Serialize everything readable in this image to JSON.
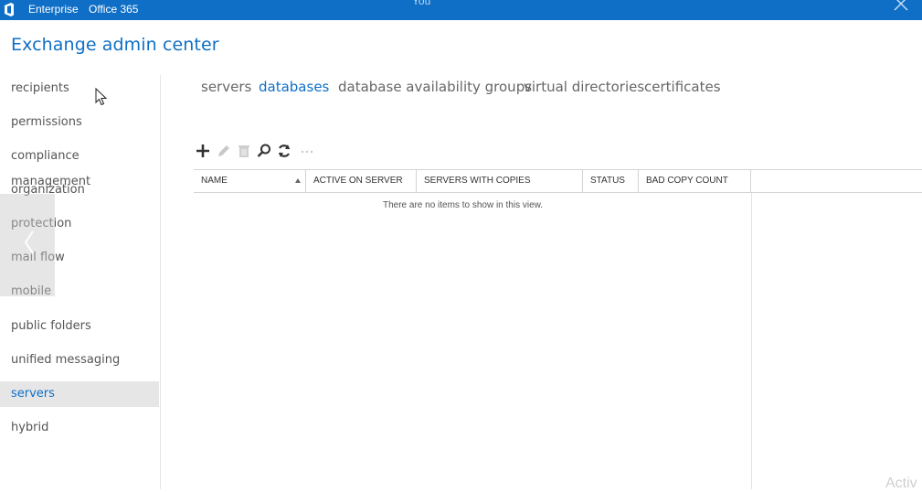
{
  "topbar": {
    "brand": "Enterprise",
    "suite": "Office 365",
    "user_partial": "You"
  },
  "app_title": "Exchange admin center",
  "nav": {
    "items": [
      {
        "label": "recipients",
        "selected": false
      },
      {
        "label": "permissions",
        "selected": false
      },
      {
        "label": "compliance management",
        "selected": false
      },
      {
        "label": "organization",
        "selected": false
      },
      {
        "label": "protection",
        "selected": false
      },
      {
        "label": "mail flow",
        "selected": false
      },
      {
        "label": "mobile",
        "selected": false
      },
      {
        "label": "public folders",
        "selected": false
      },
      {
        "label": "unified messaging",
        "selected": false
      },
      {
        "label": "servers",
        "selected": true
      },
      {
        "label": "hybrid",
        "selected": false
      }
    ]
  },
  "tabs": [
    {
      "label": "servers",
      "active": false
    },
    {
      "label": "databases",
      "active": true
    },
    {
      "label": "database availability groups",
      "active": false
    },
    {
      "label": "virtual directories",
      "active": false
    },
    {
      "label": "certificates",
      "active": false
    }
  ],
  "toolbar": {
    "icons": [
      "add-icon",
      "edit-icon",
      "delete-icon",
      "search-icon",
      "refresh-icon",
      "more-icon"
    ]
  },
  "table": {
    "columns": [
      {
        "label": "NAME",
        "sorted": "ascending"
      },
      {
        "label": "ACTIVE ON SERVER"
      },
      {
        "label": "SERVERS WITH COPIES"
      },
      {
        "label": "STATUS"
      },
      {
        "label": "BAD COPY COUNT"
      }
    ],
    "empty_message": "There are no items to show in this view."
  },
  "watermark": "Activ",
  "colors": {
    "accent": "#0f6fc6",
    "selected_nav_bg": "#e6e6e6"
  }
}
